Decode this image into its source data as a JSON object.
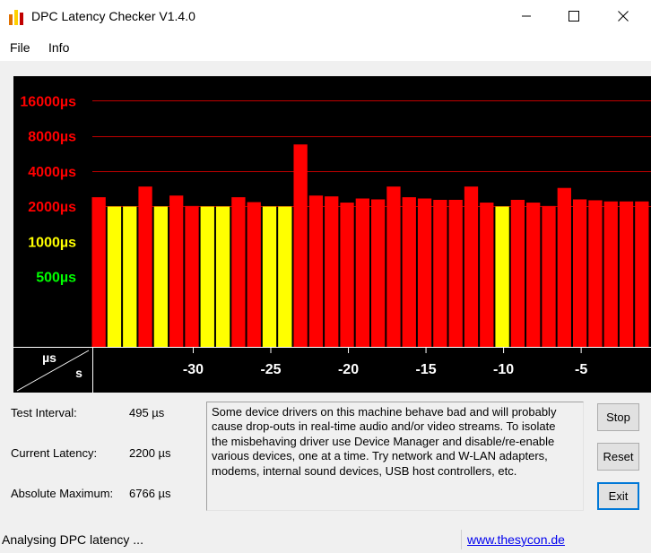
{
  "window": {
    "title": "DPC Latency Checker V1.4.0",
    "icon": "bar-chart-app-icon",
    "controls": [
      "minimize",
      "maximize",
      "close"
    ]
  },
  "menu": {
    "file": "File",
    "info": "Info"
  },
  "chart_data": {
    "type": "bar",
    "y_labels": [
      {
        "text": "16000µs",
        "value": 16000,
        "color": "#ff0000",
        "gridline": true
      },
      {
        "text": "8000µs",
        "value": 8000,
        "color": "#ff0000",
        "gridline": true
      },
      {
        "text": "4000µs",
        "value": 4000,
        "color": "#ff0000",
        "gridline": true
      },
      {
        "text": "2000µs",
        "value": 2000,
        "color": "#ff0000",
        "gridline": true
      },
      {
        "text": "1000µs",
        "value": 1000,
        "color": "#ffff00",
        "gridline": false
      },
      {
        "text": "500µs",
        "value": 500,
        "color": "#00ff00",
        "gridline": false
      }
    ],
    "y_scale": "log2",
    "ylim": [
      125,
      26000
    ],
    "axis_unit_y": "µs",
    "axis_unit_x": "s",
    "x_ticks": [
      "-30",
      "-25",
      "-20",
      "-15",
      "-10",
      "-5"
    ],
    "x_tick_values": [
      -30,
      -25,
      -20,
      -15,
      -10,
      -5
    ],
    "xlim": [
      -36,
      0
    ],
    "x_values": [
      -36,
      -35,
      -34,
      -33,
      -32,
      -31,
      -30,
      -29,
      -28,
      -27,
      -26,
      -25,
      -24,
      -23,
      -22,
      -21,
      -20,
      -19,
      -18,
      -17,
      -16,
      -15,
      -14,
      -13,
      -12,
      -11,
      -10,
      -9,
      -8,
      -7,
      -6,
      -5,
      -4,
      -3,
      -2,
      -1
    ],
    "values": [
      2390,
      1990,
      1990,
      2950,
      1990,
      2470,
      2010,
      1990,
      1990,
      2390,
      2170,
      1990,
      1990,
      6766,
      2470,
      2430,
      2150,
      2330,
      2290,
      2950,
      2390,
      2330,
      2270,
      2270,
      2950,
      2150,
      1990,
      2270,
      2150,
      2010,
      2870,
      2290,
      2250,
      2200,
      2200,
      2200
    ],
    "threshold_yellow": 2000,
    "color_high": "#ff0000",
    "color_low": "#ffff00",
    "gridline_color": "#c00000",
    "background": "#000000"
  },
  "stats": {
    "test_interval_label": "Test Interval:",
    "test_interval_value": "495 µs",
    "current_latency_label": "Current Latency:",
    "current_latency_value": "2200 µs",
    "absolute_maximum_label": "Absolute Maximum:",
    "absolute_maximum_value": "6766 µs"
  },
  "message": "Some device drivers on this machine behave bad and will probably cause drop-outs in real-time audio and/or video streams. To isolate the misbehaving driver use Device Manager and disable/re-enable various devices, one at a time. Try network and W-LAN adapters, modems, internal sound devices, USB host controllers, etc.",
  "buttons": {
    "stop": "Stop",
    "reset": "Reset",
    "exit": "Exit"
  },
  "status": {
    "text": "Analysing DPC latency ...",
    "link": "www.thesycon.de"
  }
}
